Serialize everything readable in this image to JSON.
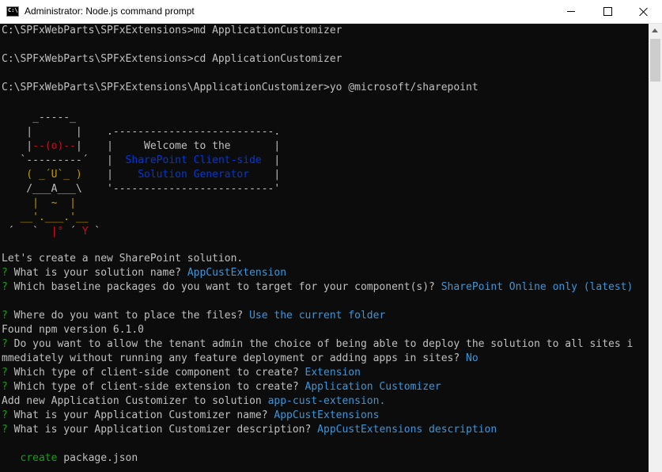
{
  "window": {
    "title": "Administrator: Node.js command prompt",
    "icon_name": "cmd-app-icon",
    "icon_text": "C:\\"
  },
  "console": {
    "cmd1": "C:\\SPFxWebParts\\SPFxExtensions>md ApplicationCustomizer",
    "cmd2": "C:\\SPFxWebParts\\SPFxExtensions>cd ApplicationCustomizer",
    "cmd3": "C:\\SPFxWebParts\\SPFxExtensions\\ApplicationCustomizer>yo @microsoft/sharepoint",
    "banner": {
      "welcome": "Welcome to the",
      "line2": "SharePoint Client-side",
      "line3": "Solution Generator"
    },
    "intro": "Let's create a new SharePoint solution.",
    "prompts": [
      {
        "q": "What is your solution name?",
        "a": "AppCustExtension"
      },
      {
        "q": "Which baseline packages do you want to target for your component(s)?",
        "a": "SharePoint Online only (latest)"
      },
      {
        "q": "Where do you want to place the files?",
        "a": "Use the current folder"
      },
      {
        "q": "Do you want to allow the tenant admin the choice of being able to deploy the solution to all sites i",
        "q2": "mmediately without running any feature deployment or adding apps in sites?",
        "a": "No"
      },
      {
        "q": "Which type of client-side component to create?",
        "a": "Extension"
      },
      {
        "q": "Which type of client-side extension to create?",
        "a": "Application Customizer"
      },
      {
        "q": "What is your Application Customizer name?",
        "a": "AppCustExtensions"
      },
      {
        "q": "What is your Application Customizer description?",
        "a": "AppCustExtensions description"
      }
    ],
    "npm_found": "Found npm version 6.1.0",
    "add_prefix": "Add new Application Customizer to solution",
    "add_name": "app-cust-extension.",
    "create_word": "create",
    "create_file": "package.json",
    "prompt_marker": "?"
  },
  "colors": {
    "background": "#0c0c0c",
    "text": "#c0c0c0",
    "prompt_green": "#13a10e",
    "answer_cyan": "#3a96dd"
  }
}
